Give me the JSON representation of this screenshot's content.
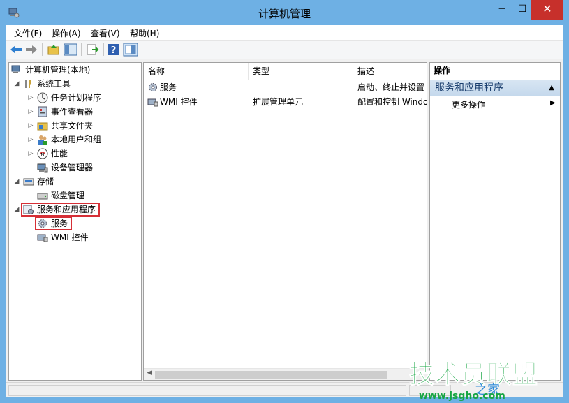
{
  "window": {
    "title": "计算机管理",
    "min_glyph": "─",
    "max_glyph": "☐",
    "close_glyph": "✕"
  },
  "menu": [
    "文件(F)",
    "操作(A)",
    "查看(V)",
    "帮助(H)"
  ],
  "tree": {
    "root": "计算机管理(本地)",
    "system_tools": "系统工具",
    "task_scheduler": "任务计划程序",
    "event_viewer": "事件查看器",
    "shared_folders": "共享文件夹",
    "local_users": "本地用户和组",
    "performance": "性能",
    "device_manager": "设备管理器",
    "storage": "存储",
    "disk_management": "磁盘管理",
    "services_apps": "服务和应用程序",
    "services": "服务",
    "wmi": "WMI 控件"
  },
  "list": {
    "columns": [
      "名称",
      "类型",
      "描述"
    ],
    "rows": [
      {
        "name": "服务",
        "type": "",
        "desc": "启动、终止并设置"
      },
      {
        "name": "WMI 控件",
        "type": "扩展管理单元",
        "desc": "配置和控制 Windo"
      }
    ]
  },
  "actions": {
    "header": "操作",
    "section": "服务和应用程序",
    "more": "更多操作"
  },
  "watermark": {
    "main": "技术员联盟",
    "url": "www.jsgho.com",
    "sub": "之家"
  },
  "colors": {
    "accent_highlight": "#d62f36",
    "close_button": "#c7302b",
    "watermark_green": "#17a543"
  }
}
